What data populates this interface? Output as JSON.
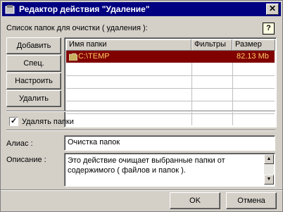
{
  "window": {
    "title": "Редактор действия \"Удаление\""
  },
  "folder_list": {
    "label": "Список папок для очистки ( удаления ):",
    "columns": [
      "Имя папки",
      "Фильтры",
      "Размер"
    ],
    "rows": [
      {
        "name": "C:\\TEMP",
        "filter": "",
        "size": "82.13 Mb"
      }
    ]
  },
  "buttons": {
    "add": "Добавить",
    "special": "Спец.",
    "configure": "Настроить",
    "delete": "Удалить",
    "ok": "OK",
    "cancel": "Отмена",
    "help": "?"
  },
  "delete_folders": {
    "label": "Удалять папки",
    "checked": true
  },
  "alias": {
    "label": "Алиас :",
    "value": "Очистка папок"
  },
  "description": {
    "label": "Описание :",
    "value": "Это действие очищает выбранные папки от содержимого ( файлов и папок )."
  },
  "colors": {
    "title_bar": "#000080",
    "selected_row": "#800000",
    "selected_text": "#ffcc66"
  },
  "icons": [
    "app-icon",
    "close-icon",
    "help-icon",
    "folder-icon",
    "check-icon",
    "scroll-up-icon",
    "scroll-down-icon"
  ]
}
